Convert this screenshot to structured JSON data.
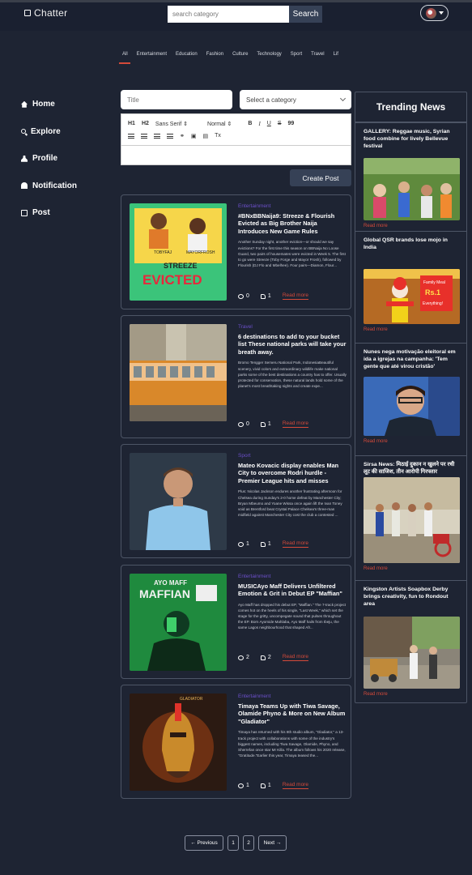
{
  "header": {
    "logo": "Chatter",
    "search_placeholder": "search category",
    "search_button": "Search"
  },
  "categories": [
    "All",
    "Entertainment",
    "Education",
    "Fashion",
    "Culture",
    "Technology",
    "Sport",
    "Travel",
    "Lif"
  ],
  "sidebar": {
    "items": [
      {
        "label": "Home",
        "icon": "home-icon"
      },
      {
        "label": "Explore",
        "icon": "search-icon"
      },
      {
        "label": "Profile",
        "icon": "user-icon"
      },
      {
        "label": "Notification",
        "icon": "bell-icon"
      },
      {
        "label": "Post",
        "icon": "post-icon"
      }
    ]
  },
  "editor": {
    "title_placeholder": "Title",
    "category_select": "Select a category",
    "font_family": "Sans Serif",
    "font_size": "Normal",
    "heading1": "H1",
    "heading2": "H2",
    "bold": "B",
    "italic": "I",
    "underline": "U",
    "strike": "S",
    "quote": "99",
    "clear": "Tx",
    "create_button": "Create Post"
  },
  "posts": [
    {
      "category": "Entertainment",
      "title": "#BNxBBNaija9: Streeze & Flourish Evicted as Big Brother Naija Introduces New Game Rules",
      "excerpt": "Another Sunday night, another eviction—or should we say evictions? For the first time this season on BBNaija No Loose Guard, two pairs of housemates were evicted in Week 5. The first to go were Streeze (Toby Forge and Mayor Frosh), followed by Flourish (DJ Flo and Mbelhee). Four pairs—Diamon, Flour...",
      "comments": "0",
      "likes": "1",
      "read_more": "Read more"
    },
    {
      "category": "Travel",
      "title": "6 destinations to add to your bucket list These national parks will take your breath away.",
      "excerpt": "Bromo Tengger Semeru National Park, IndonesiaBeautiful scenery, vivid colors and extraordinary wildlife make national parks some of the best destinations a country has to offer. Usually protected for conservation, these natural lands hold some of the planet's most breathtaking sights and create expe...",
      "comments": "0",
      "likes": "1",
      "read_more": "Read more"
    },
    {
      "category": "Sport",
      "title": "Mateo Kovacic display enables Man City to overcome Rodri hurdle - Premier League hits and misses",
      "excerpt": "Plus: Nicolas Jackson endures another frustrating afternoon for Chelsea during Sunday's 2-0 home defeat by Manchester City; Bryan Mbeumo and Yoane Wissa once again lift the Ivan Toney void as Brentford beat Crystal Palace Chelsea's three-man midfield against Manchester City cost the club a contested ...",
      "comments": "1",
      "likes": "1",
      "read_more": "Read more"
    },
    {
      "category": "Entertainment",
      "title": "MUSICAyo Maff Delivers Unfiltered Emotion & Grit in Debut EP \"Maffian\"",
      "excerpt": "Ayo Maff has dropped his debut EP, \"Maffian.\" The 7-track project comes hot on the heels of his single, \"Last Week,\" which set the stage for the gritty, uncompegate sound that pulses throughout the EP. Born Ayomide Mahlaba, Ayo Maff hails from Ibeju, the same Lagos neighbourhood that shaped Afr...",
      "comments": "2",
      "likes": "2",
      "read_more": "Read more"
    },
    {
      "category": "Entertainment",
      "title": "Timaya Teams Up with Tiwa Savage, Olamide Phyno & More on New Album \"Gladiator\"",
      "excerpt": "Timaya has returned with his 8th studio album, \"Gladiator,\" a 13-track project with collaborations with some of the industry's biggest names, including Tiwa Savage, Olamide, Phyno, and Sherrefan once star Mr Killa. The album follows his 2020 release, \"Gratitude.\"Earlier this year, Timaya teased the...",
      "comments": "1",
      "likes": "1",
      "read_more": "Read more"
    }
  ],
  "trending": {
    "heading": "Trending News",
    "items": [
      {
        "title": "GALLERY: Reggae music, Syrian food combine for lively Bellevue festival",
        "read_more": "Read more"
      },
      {
        "title": "Global QSR brands lose mojo in India",
        "read_more": "Read more"
      },
      {
        "title": "Nunes nega motivação eleitoral em ida a igrejas na campanha: 'Tem gente que até virou cristão'",
        "read_more": "Read more"
      },
      {
        "title": "Sirsa News: मिठाई दुकान न खुलने पर रची लूट की साजिश, तीन आरोपी गिरफ्तार",
        "read_more": "Read more"
      },
      {
        "title": "Kingston Artists Soapbox Derby brings creativity, fun to Rondout area",
        "read_more": "Read more"
      }
    ],
    "poster_text": [
      "Family Meal",
      "Rs.1",
      "Everything!"
    ]
  },
  "thumbs": {
    "post1_tags": [
      "TOBYFAJ",
      "MAYORFROSH",
      "STREEZE",
      "EVICTED"
    ],
    "post4_tag": "AYO MAFF",
    "post4_word": "MAFFIAN",
    "post5_word": "GLADIATOR"
  },
  "pagination": {
    "prev": "← Previous",
    "pages": [
      "1",
      "2"
    ],
    "next": "Next →"
  },
  "colors": {
    "background": "#1e2433",
    "accent": "#d44a3a",
    "category": "#6b4fc9",
    "button": "#364156"
  }
}
